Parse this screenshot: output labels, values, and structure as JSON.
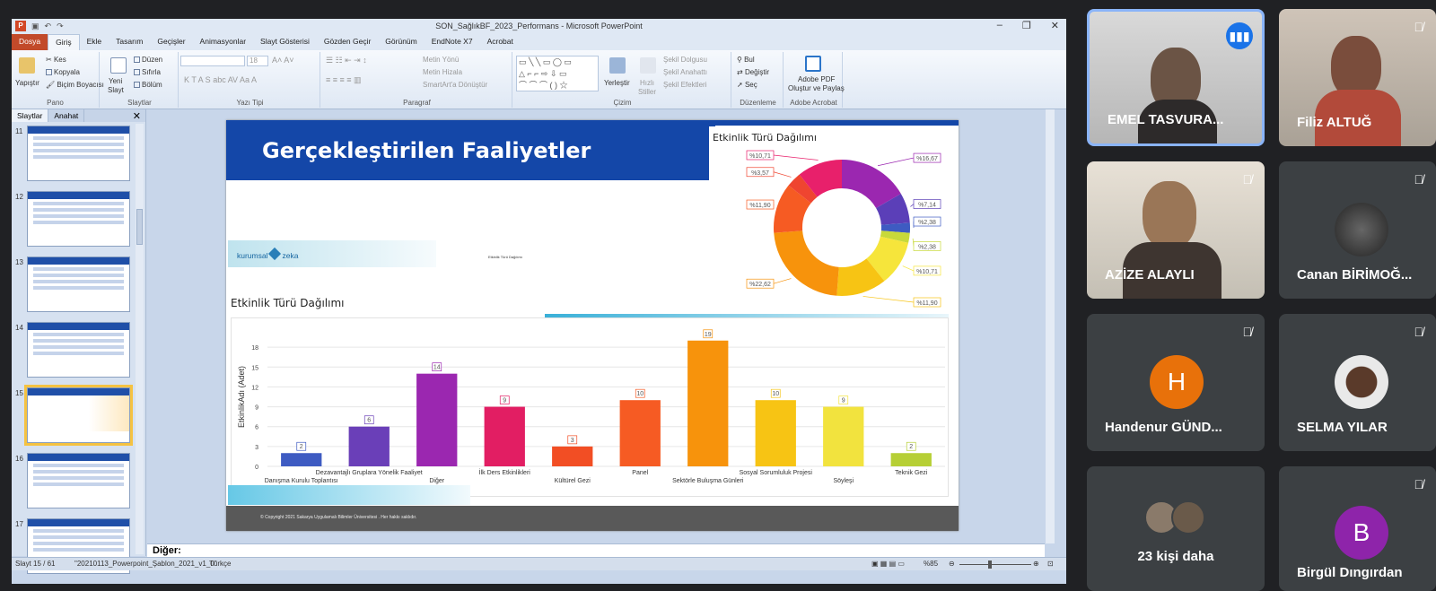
{
  "window": {
    "title": "SON_SağlıkBF_2023_Performans - Microsoft PowerPoint",
    "minimize": "–",
    "restore": "❐",
    "close": "✕"
  },
  "tabs": [
    "Dosya",
    "Giriş",
    "Ekle",
    "Tasarım",
    "Geçişler",
    "Animasyonlar",
    "Slayt Gösterisi",
    "Gözden Geçir",
    "Görünüm",
    "EndNote X7",
    "Acrobat"
  ],
  "ribbon": {
    "pano": {
      "label": "Pano",
      "paste": "Yapıştır",
      "cut": "Kes",
      "copy": "Kopyala",
      "format_painter": "Biçim Boyacısı"
    },
    "slaytlar": {
      "label": "Slaytlar",
      "new_slide": "Yeni",
      "new_slide2": "Slayt",
      "layout": "Düzen",
      "reset": "Sıfırla",
      "section": "Bölüm"
    },
    "yazi_tipi": {
      "label": "Yazı Tipi",
      "font_size": "18"
    },
    "paragraf": {
      "label": "Paragraf",
      "text_direction": "Metin Yönü",
      "align_text": "Metin Hizala",
      "smartart": "SmartArt'a Dönüştür"
    },
    "cizim": {
      "label": "Çizim",
      "arrange": "Yerleştir",
      "quick_styles": "Hızlı",
      "quick_styles2": "Stiller",
      "shape_fill": "Şekil Dolgusu",
      "shape_outline": "Şekil Anahattı",
      "shape_effects": "Şekil Efektleri"
    },
    "duzenleme": {
      "label": "Düzenleme",
      "find": "Bul",
      "replace": "Değiştir",
      "select": "Seç"
    },
    "acrobat": {
      "label": "Adobe Acrobat",
      "create_pdf": "Adobe PDF",
      "create_pdf2": "Oluştur ve Paylaş"
    }
  },
  "panel": {
    "tabs": [
      "Slaytlar",
      "Anahat"
    ],
    "close": "✕",
    "thumbs": [
      {
        "num": "11"
      },
      {
        "num": "12"
      },
      {
        "num": "13"
      },
      {
        "num": "14"
      },
      {
        "num": "15",
        "selected": true
      },
      {
        "num": "16"
      },
      {
        "num": "17"
      }
    ]
  },
  "slide": {
    "title": "Gerçekleştirilen Faaliyetler",
    "logo_left": "kurumsal",
    "logo_right": "zeka",
    "tiny_text": "Etkinlik Türü Dağılımı",
    "footer": "© Copyright 2021 Sakarya Uygulamalı Bilimler Üniversitesi . Her hakkı saklıdır."
  },
  "chart_data": [
    {
      "type": "pie",
      "title": "Etkinlik Türü Dağılımı",
      "donut": true,
      "slices": [
        {
          "label": "%16,67",
          "value": 16.67,
          "color": "#9b27b0"
        },
        {
          "label": "%7,14",
          "value": 7.14,
          "color": "#5b3fb8"
        },
        {
          "label": "%2,38",
          "value": 2.38,
          "color": "#3e5bc2"
        },
        {
          "label": "%2,38",
          "value": 2.38,
          "color": "#c8d93a"
        },
        {
          "label": "%10,71",
          "value": 10.71,
          "color": "#f6e53b"
        },
        {
          "label": "%11,90",
          "value": 11.9,
          "color": "#f7c414"
        },
        {
          "label": "%22,62",
          "value": 22.62,
          "color": "#f7930c"
        },
        {
          "label": "%11,90",
          "value": 11.9,
          "color": "#f65b23"
        },
        {
          "label": "%3,57",
          "value": 3.57,
          "color": "#ef4530"
        },
        {
          "label": "%10,71",
          "value": 10.71,
          "color": "#e8206b"
        }
      ]
    },
    {
      "type": "bar",
      "title": "Etkinlik Türü Dağılımı",
      "ylabel": "EtkinlikAdı (Adet)",
      "ylim": [
        0,
        21
      ],
      "yticks": [
        0,
        3,
        6,
        9,
        12,
        15,
        18
      ],
      "categories": [
        "Danışma Kurulu Toplantısı",
        "Dezavantajlı Gruplara Yönelik Faaliyet",
        "Diğer",
        "İlk Ders Etkinlikleri",
        "Kültürel Gezi",
        "Panel",
        "Sektörle Buluşma Günleri",
        "Sosyal Sorumluluk Projesi",
        "Söyleşi",
        "Teknik Gezi"
      ],
      "values": [
        2,
        6,
        14,
        9,
        3,
        10,
        19,
        10,
        9,
        2
      ],
      "colors": [
        "#3e5bc2",
        "#6a3fb8",
        "#9b27b0",
        "#e21e63",
        "#f24e24",
        "#f65b23",
        "#f7930c",
        "#f7c414",
        "#f2e33e",
        "#b6cf35"
      ]
    }
  ],
  "notes": {
    "label": "Diğer:"
  },
  "status": {
    "slide": "Slayt 15 / 61",
    "theme": "\"20210113_Powerpoint_Şablon_2021_v1_0\"",
    "lang": "Türkçe",
    "zoom": "%85"
  },
  "meet": {
    "tiles": [
      {
        "name": "EMEL TASVURA...",
        "type": "video",
        "speaking": true
      },
      {
        "name": "Filiz ALTUĞ",
        "type": "video"
      },
      {
        "name": "AZİZE ALAYLI",
        "type": "video"
      },
      {
        "name": "Canan BİRİMOĞ...",
        "type": "photo"
      },
      {
        "name": "Handenur GÜND...",
        "type": "letter",
        "letter": "H",
        "color": "#e8710a"
      },
      {
        "name": "SELMA YILAR",
        "type": "photo"
      },
      {
        "name": "23 kişi daha",
        "type": "group"
      },
      {
        "name": "Birgül Dıngırdan",
        "type": "letter",
        "letter": "B",
        "color": "#8e24aa"
      }
    ]
  }
}
